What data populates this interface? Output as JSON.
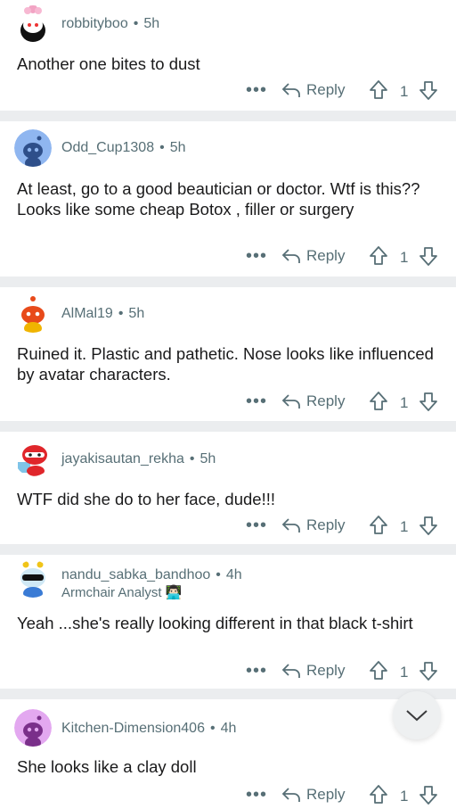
{
  "comments": [
    {
      "username": "robbityboo",
      "time": "5h",
      "text": "Another one bites to dust",
      "reply_label": "Reply",
      "votes": "1",
      "more": "•••",
      "avatar_icon": "snoo-avatar-pink-flower"
    },
    {
      "username": "Odd_Cup1308",
      "time": "5h",
      "text": "At least, go to a good beautician or doctor. Wtf is this?? Looks like some cheap Botox , filler or surgery",
      "reply_label": "Reply",
      "votes": "1",
      "more": "•••",
      "avatar_icon": "default-blue-avatar"
    },
    {
      "username": "AlMal19",
      "time": "5h",
      "text": "Ruined it. Plastic and pathetic. Nose looks like influenced by avatar characters.",
      "reply_label": "Reply",
      "votes": "1",
      "more": "•••",
      "avatar_icon": "snoo-avatar-red"
    },
    {
      "username": "jayakisautan_rekha",
      "time": "5h",
      "text": "WTF did she do to her face, dude!!!",
      "reply_label": "Reply",
      "votes": "1",
      "more": "•••",
      "avatar_icon": "snoo-avatar-red-mask"
    },
    {
      "username": "nandu_sabka_bandhoo",
      "time": "4h",
      "flair": "Armchair Analyst 👨🏻‍💻",
      "text": "Yeah ...she's really looking different in that black t-shirt",
      "reply_label": "Reply",
      "votes": "1",
      "more": "•••",
      "avatar_icon": "snoo-avatar-sunglasses"
    },
    {
      "username": "Kitchen-Dimension406",
      "time": "4h",
      "text": "She looks like a clay doll",
      "reply_label": "Reply",
      "votes": "1",
      "more": "•••",
      "avatar_icon": "default-purple-avatar"
    }
  ],
  "colors": {
    "meta": "#576f76",
    "separator": "#ebedef",
    "text": "#1a1a1b"
  },
  "scroll_button": {
    "icon": "chevron-down-icon"
  }
}
